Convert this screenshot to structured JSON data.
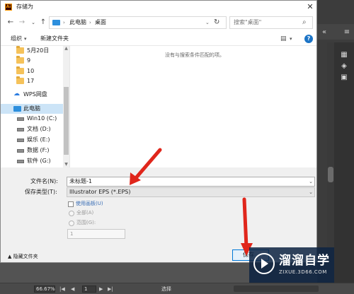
{
  "dialog": {
    "title": "存储为",
    "close_icon": "close-icon"
  },
  "navbar": {
    "path": [
      "此电脑",
      "桌面"
    ],
    "search_placeholder": "搜索\"桌面\""
  },
  "toolbar": {
    "organize": "组织",
    "new_folder": "新建文件夹"
  },
  "sidebar": {
    "items": [
      {
        "label": "5月20日",
        "icon": "folder-icon"
      },
      {
        "label": "9",
        "icon": "folder-icon"
      },
      {
        "label": "10",
        "icon": "folder-icon"
      },
      {
        "label": "17",
        "icon": "folder-icon"
      },
      {
        "label": "WPS网盘",
        "icon": "cloud-icon"
      },
      {
        "label": "此电脑",
        "icon": "computer-icon",
        "selected": true
      },
      {
        "label": "Win10 (C:)",
        "icon": "drive-icon"
      },
      {
        "label": "文档 (D:)",
        "icon": "drive-icon"
      },
      {
        "label": "娱乐 (E:)",
        "icon": "drive-icon"
      },
      {
        "label": "数据 (F:)",
        "icon": "drive-icon"
      },
      {
        "label": "软件 (G:)",
        "icon": "drive-icon"
      }
    ]
  },
  "main": {
    "empty_message": "没有与搜索条件匹配的项。"
  },
  "form": {
    "filename_label": "文件名(N):",
    "filename_value": "未标题-1",
    "type_label": "保存类型(T):",
    "type_value": "Illustrator EPS (*.EPS)",
    "use_artboards": "使用画板(U)",
    "all": "全部(A)",
    "range": "范围(G):",
    "range_value": "1"
  },
  "footer": {
    "hide_folders": "隐藏文件夹",
    "save_button": "保存"
  },
  "illustrator": {
    "zoom": "66.67%",
    "page": "1",
    "status": "选择"
  },
  "watermark": {
    "title": "溜溜自学",
    "url": "ZIXUE.3D66.COM"
  },
  "colors": {
    "accent": "#0078d7",
    "arrow": "#e0261b",
    "selection": "#cce4f7"
  }
}
